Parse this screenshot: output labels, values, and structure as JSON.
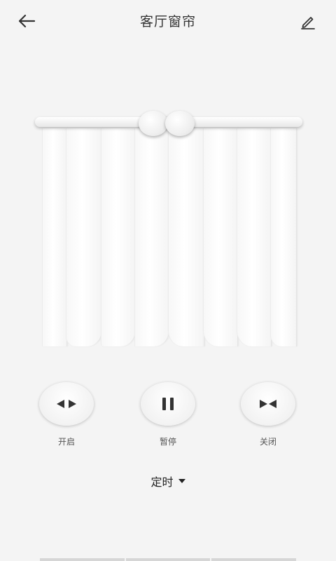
{
  "header": {
    "title": "客厅窗帘",
    "back_icon": "arrow-left-icon",
    "edit_icon": "pencil-icon"
  },
  "controls": [
    {
      "label": "开启",
      "icon": "open-arrows-icon"
    },
    {
      "label": "暂停",
      "icon": "pause-icon"
    },
    {
      "label": "关闭",
      "icon": "close-arrows-icon"
    }
  ],
  "timer": {
    "label": "定时",
    "icon": "caret-down-icon"
  },
  "colors": {
    "background": "#f4f4f4",
    "text": "#333333",
    "icon": "#333333"
  }
}
